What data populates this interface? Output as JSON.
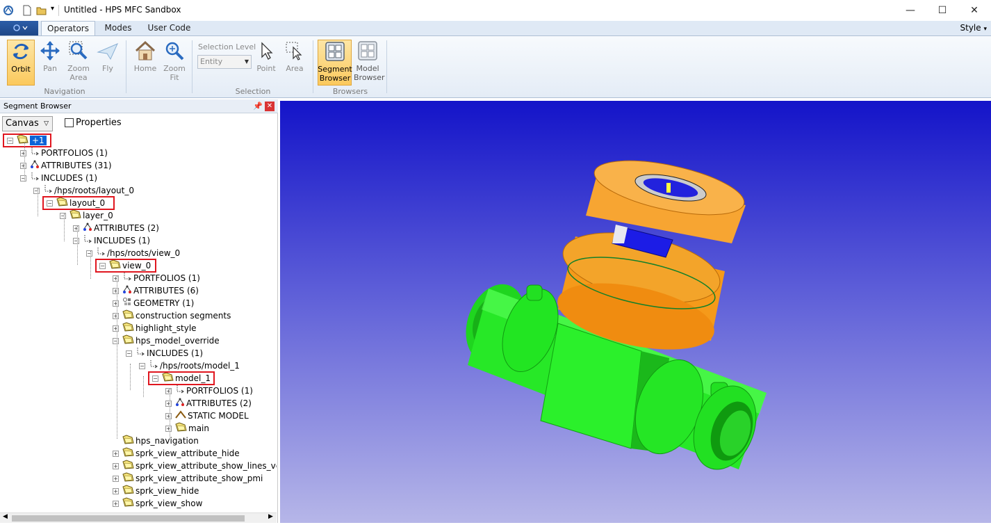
{
  "window": {
    "title": "Untitled - HPS MFC Sandbox",
    "minimize": "—",
    "maximize": "☐",
    "close": "✕"
  },
  "ribbon": {
    "tabs": [
      "Operators",
      "Modes",
      "User Code"
    ],
    "active_tab": "Operators",
    "style_label": "Style",
    "groups": {
      "navigation": {
        "label": "Navigation",
        "orbit": "Orbit",
        "pan": "Pan",
        "zoom_area": "Zoom Area",
        "fly": "Fly"
      },
      "home_group": {
        "home": "Home",
        "zoom_fit": "Zoom Fit"
      },
      "selection": {
        "label": "Selection",
        "level_label": "Selection Level",
        "level_value": "Entity",
        "point": "Point",
        "area": "Area"
      },
      "browsers": {
        "label": "Browsers",
        "segment_browser": "Segment Browser",
        "model_browser": "Model Browser"
      }
    }
  },
  "panel": {
    "title": "Segment Browser",
    "canvas_select": "Canvas",
    "properties_label": "Properties",
    "tree": [
      {
        "label": "+1",
        "depth": 0,
        "icon": "folder",
        "exp": "-",
        "highlight": true,
        "selected": true
      },
      {
        "label": "PORTFOLIOS (1)",
        "depth": 1,
        "icon": "include",
        "exp": "+"
      },
      {
        "label": "ATTRIBUTES (31)",
        "depth": 1,
        "icon": "attr",
        "exp": "+"
      },
      {
        "label": "INCLUDES (1)",
        "depth": 1,
        "icon": "include",
        "exp": "-"
      },
      {
        "label": "/hps/roots/layout_0",
        "depth": 2,
        "icon": "include",
        "exp": "-"
      },
      {
        "label": "layout_0",
        "depth": 3,
        "icon": "folder",
        "exp": "-",
        "highlight": true
      },
      {
        "label": "layer_0",
        "depth": 4,
        "icon": "folder",
        "exp": "-"
      },
      {
        "label": "ATTRIBUTES (2)",
        "depth": 5,
        "icon": "attr",
        "exp": "+"
      },
      {
        "label": "INCLUDES (1)",
        "depth": 5,
        "icon": "include",
        "exp": "-"
      },
      {
        "label": "/hps/roots/view_0",
        "depth": 6,
        "icon": "include",
        "exp": "-"
      },
      {
        "label": "view_0",
        "depth": 7,
        "icon": "folder",
        "exp": "-",
        "highlight": true
      },
      {
        "label": "PORTFOLIOS (1)",
        "depth": 8,
        "icon": "include",
        "exp": "+"
      },
      {
        "label": "ATTRIBUTES (6)",
        "depth": 8,
        "icon": "attr",
        "exp": "+"
      },
      {
        "label": "GEOMETRY (1)",
        "depth": 8,
        "icon": "geom",
        "exp": "+"
      },
      {
        "label": "construction segments",
        "depth": 8,
        "icon": "folder",
        "exp": "+"
      },
      {
        "label": "highlight_style",
        "depth": 8,
        "icon": "folder",
        "exp": "+"
      },
      {
        "label": "hps_model_override",
        "depth": 8,
        "icon": "folder",
        "exp": "-"
      },
      {
        "label": "INCLUDES (1)",
        "depth": 9,
        "icon": "include",
        "exp": "-"
      },
      {
        "label": "/hps/roots/model_1",
        "depth": 10,
        "icon": "include",
        "exp": "-"
      },
      {
        "label": "model_1",
        "depth": 11,
        "icon": "folder",
        "exp": "-",
        "highlight": true
      },
      {
        "label": "PORTFOLIOS (1)",
        "depth": 12,
        "icon": "include",
        "exp": "+"
      },
      {
        "label": "ATTRIBUTES (2)",
        "depth": 12,
        "icon": "attr",
        "exp": "+"
      },
      {
        "label": "STATIC MODEL",
        "depth": 12,
        "icon": "static",
        "exp": "+"
      },
      {
        "label": "main",
        "depth": 12,
        "icon": "folder",
        "exp": "+"
      },
      {
        "label": "hps_navigation",
        "depth": 8,
        "icon": "folder",
        "exp": ""
      },
      {
        "label": "sprk_view_attribute_hide",
        "depth": 8,
        "icon": "folder",
        "exp": "+"
      },
      {
        "label": "sprk_view_attribute_show_lines_vertice",
        "depth": 8,
        "icon": "folder",
        "exp": "+"
      },
      {
        "label": "sprk_view_attribute_show_pmi",
        "depth": 8,
        "icon": "folder",
        "exp": "+"
      },
      {
        "label": "sprk_view_hide",
        "depth": 8,
        "icon": "folder",
        "exp": "+"
      },
      {
        "label": "sprk_view_show",
        "depth": 8,
        "icon": "folder",
        "exp": "+"
      }
    ]
  },
  "viewport": {
    "model_colors": {
      "body": "#22ee22",
      "cap": "#f59a1a",
      "insert": "#2222dd"
    }
  }
}
